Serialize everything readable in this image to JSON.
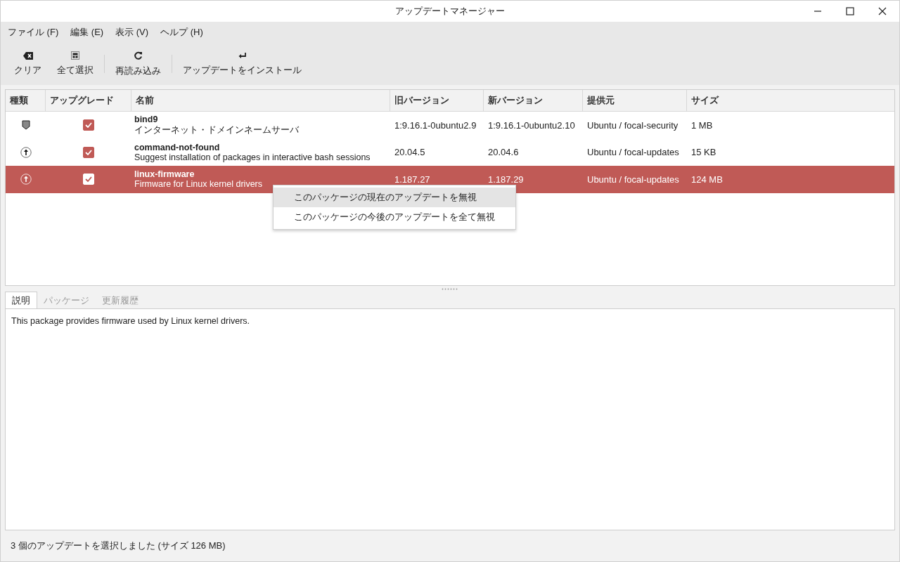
{
  "window": {
    "title": "アップデートマネージャー"
  },
  "menu": [
    "ファイル (F)",
    "編集 (E)",
    "表示 (V)",
    "ヘルプ (H)"
  ],
  "toolbar": [
    {
      "kind": "clear",
      "label": "クリア"
    },
    {
      "kind": "select_all",
      "label": "全て選択"
    },
    {
      "kind": "refresh",
      "label": "再読み込み"
    },
    {
      "kind": "install",
      "label": "アップデートをインストール"
    }
  ],
  "table": {
    "columns": [
      "種類",
      "アップグレード",
      "名前",
      "旧バージョン",
      "新バージョン",
      "提供元",
      "サイズ"
    ],
    "rows": [
      {
        "kind": "security",
        "upgrade": true,
        "selected": false,
        "name": "bind9",
        "description": "インターネット・ドメインネームサーバ",
        "old_version": "1:9.16.1-0ubuntu2.9",
        "new_version": "1:9.16.1-0ubuntu2.10",
        "origin": "Ubuntu / focal-security",
        "size": "1 MB"
      },
      {
        "kind": "update",
        "upgrade": true,
        "selected": false,
        "name": "command-not-found",
        "description": "Suggest installation of packages in interactive bash sessions",
        "old_version": "20.04.5",
        "new_version": "20.04.6",
        "origin": "Ubuntu / focal-updates",
        "size": "15 KB"
      },
      {
        "kind": "update",
        "upgrade": true,
        "selected": true,
        "name": "linux-firmware",
        "description": "Firmware for Linux kernel drivers",
        "old_version": "1.187.27",
        "new_version": "1.187.29",
        "origin": "Ubuntu / focal-updates",
        "size": "124 MB"
      }
    ]
  },
  "context_menu": [
    {
      "label": "このパッケージの現在のアップデートを無視",
      "highlighted": true
    },
    {
      "label": "このパッケージの今後のアップデートを全て無視",
      "highlighted": false
    }
  ],
  "tabs": [
    {
      "label": "説明",
      "selected": true
    },
    {
      "label": "パッケージ",
      "selected": false
    },
    {
      "label": "更新履歴",
      "selected": false
    }
  ],
  "details": {
    "text": "This package provides firmware used by Linux kernel drivers."
  },
  "status_bar": "3 個のアップデートを選択しました (サイズ 126 MB)"
}
